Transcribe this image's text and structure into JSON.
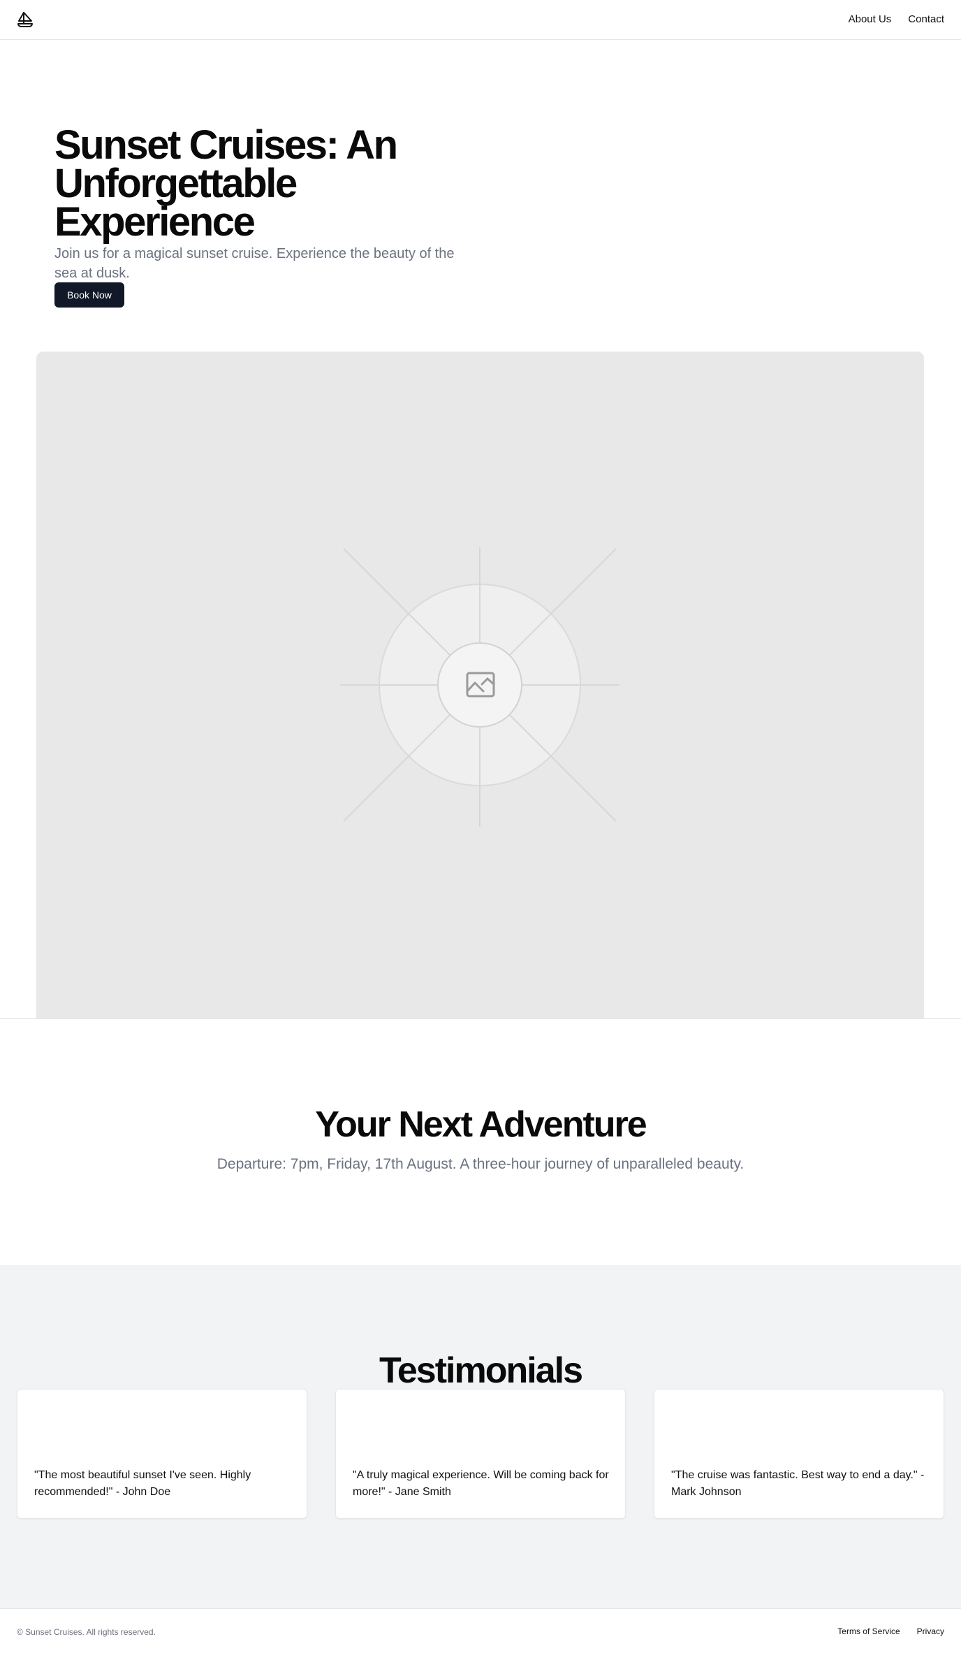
{
  "header": {
    "logo_icon": "sailboat-icon",
    "nav": [
      "About Us",
      "Contact"
    ]
  },
  "hero": {
    "title": "Sunset Cruises: An Unforgettable Experience",
    "subtitle": "Join us for a magical sunset cruise. Experience the beauty of the sea at dusk.",
    "button_label": "Book Now",
    "image_icon": "image-placeholder-icon"
  },
  "adventure": {
    "title": "Your Next Adventure",
    "subtitle": "Departure: 7pm, Friday, 17th August. A three-hour journey of unparalleled beauty."
  },
  "testimonials": {
    "title": "Testimonials",
    "items": [
      "\"The most beautiful sunset I've seen. Highly recommended!\" - John Doe",
      "\"A truly magical experience. Will be coming back for more!\" - Jane Smith",
      "\"The cruise was fantastic. Best way to end a day.\" - Mark Johnson"
    ]
  },
  "footer": {
    "copyright": "© Sunset Cruises. All rights reserved.",
    "links": [
      "Terms of Service",
      "Privacy"
    ]
  },
  "colors": {
    "primary_button": "#111827",
    "muted_text": "#6b7280",
    "section_bg": "#f2f3f5"
  }
}
